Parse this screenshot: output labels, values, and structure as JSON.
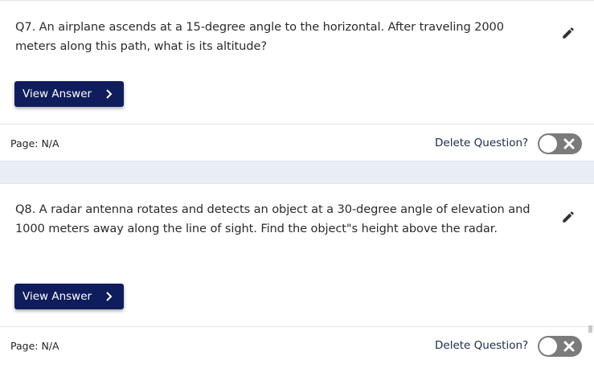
{
  "questions": [
    {
      "text": "Q7. An airplane ascends at a 15-degree angle to the horizontal. After traveling 2000 meters along this path, what is its altitude?",
      "view_answer_label": "View Answer",
      "page_label": "Page: N/A",
      "delete_label": "Delete Question?"
    },
    {
      "text": "Q8. A radar antenna rotates and detects an object at a 30-degree angle of elevation and 1000 meters away along the line of sight. Find the object\"s height above the radar.",
      "view_answer_label": "View Answer",
      "page_label": "Page: N/A",
      "delete_label": "Delete Question?"
    }
  ],
  "colors": {
    "button_bg": "#101d5c",
    "toggle_off": "#7b7b7b",
    "page_bg": "#e9eef6"
  },
  "icons": {
    "edit": "pencil-icon",
    "chevron": "chevron-right-icon",
    "toggle_x": "close-icon"
  }
}
